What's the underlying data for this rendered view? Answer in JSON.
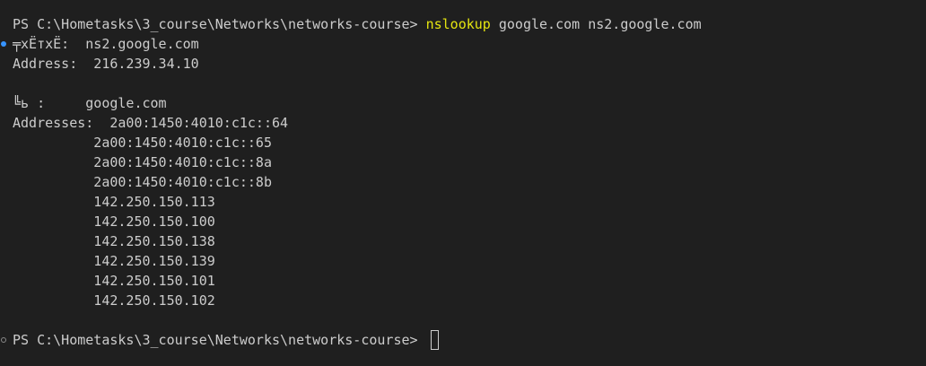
{
  "prompt": "PS C:\\Hometasks\\3_course\\Networks\\networks-course> ",
  "command": {
    "name": "nslookup",
    "args": " google.com ns2.google.com"
  },
  "output": {
    "server_line": "╤хЁтхЁ:  ns2.google.com",
    "address_line": "Address:  216.239.34.10",
    "name_line": "╚ь :     google.com",
    "addresses_first": "Addresses:  2a00:1450:4010:c1c::64",
    "addresses_rest": [
      "          2a00:1450:4010:c1c::65",
      "          2a00:1450:4010:c1c::8a",
      "          2a00:1450:4010:c1c::8b",
      "          142.250.150.113",
      "          142.250.150.100",
      "          142.250.150.138",
      "          142.250.150.139",
      "          142.250.150.101",
      "          142.250.150.102"
    ]
  },
  "colors": {
    "background": "#1f1f1f",
    "text": "#cccccc",
    "command": "#e5e510",
    "decoration_success": "#3794ff"
  }
}
